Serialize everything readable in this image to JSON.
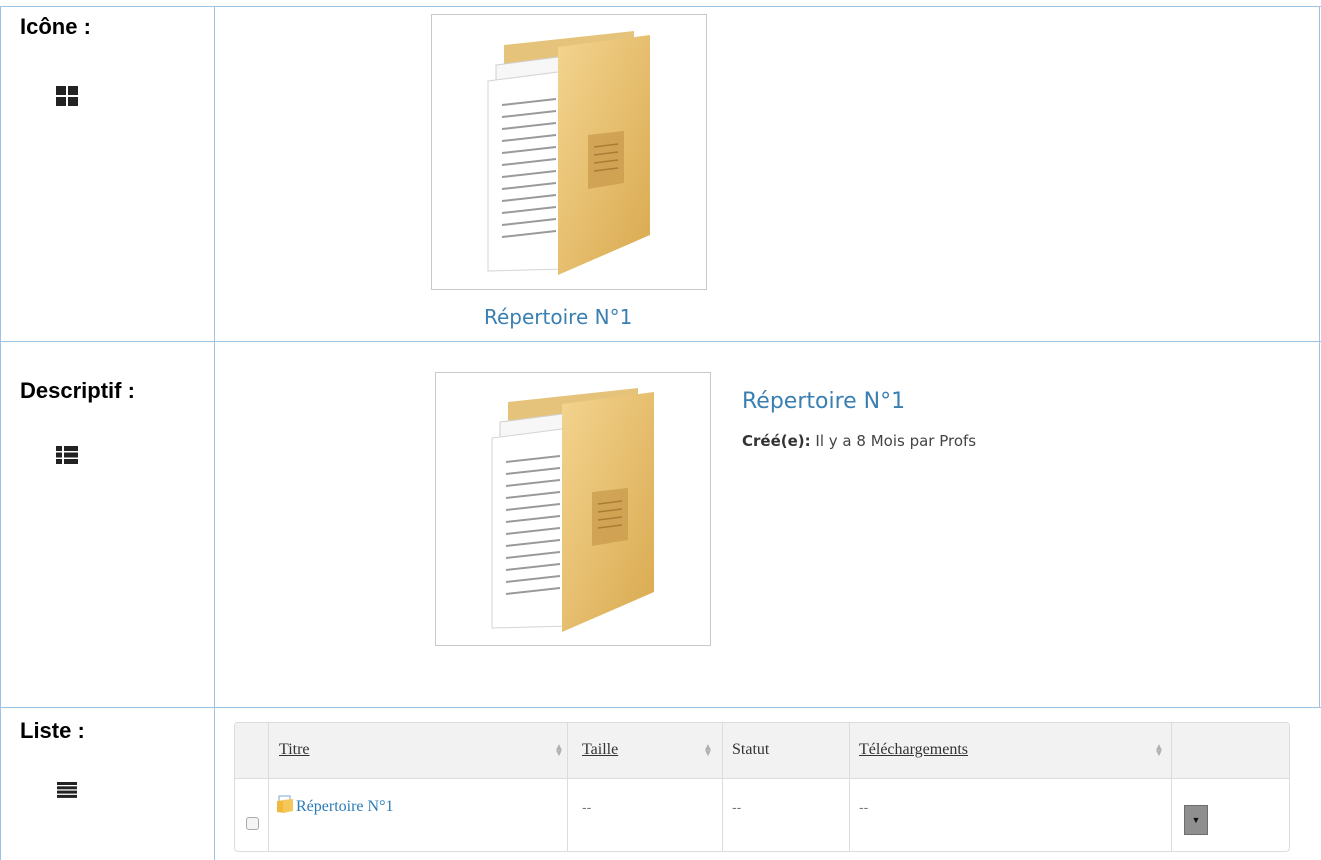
{
  "rows": {
    "icon": {
      "label": "Icône :",
      "view_icon": "grid-icon"
    },
    "descriptif": {
      "label": "Descriptif :",
      "view_icon": "detail-list-icon"
    },
    "liste": {
      "label": "Liste :",
      "view_icon": "list-icon"
    }
  },
  "icon_view": {
    "folder_name": "Répertoire N°1",
    "thumbnail": "folder-document-icon"
  },
  "descriptif_view": {
    "folder_name": "Répertoire N°1",
    "created_label": "Créé(e):",
    "created_text": "Il y a 8 Mois par Profs",
    "thumbnail": "folder-document-icon"
  },
  "list_view": {
    "columns": [
      "Titre",
      "Taille",
      "Statut",
      "Téléchargements"
    ],
    "row": {
      "title": "Répertoire N°1",
      "size": "--",
      "status": "--",
      "downloads": "--",
      "action_icon": "caret-down-icon",
      "file_icon": "folder-file-icon"
    }
  },
  "colors": {
    "border": "#9dc3e6",
    "link": "#3a7fb2",
    "folder": "#e8bf6a"
  }
}
